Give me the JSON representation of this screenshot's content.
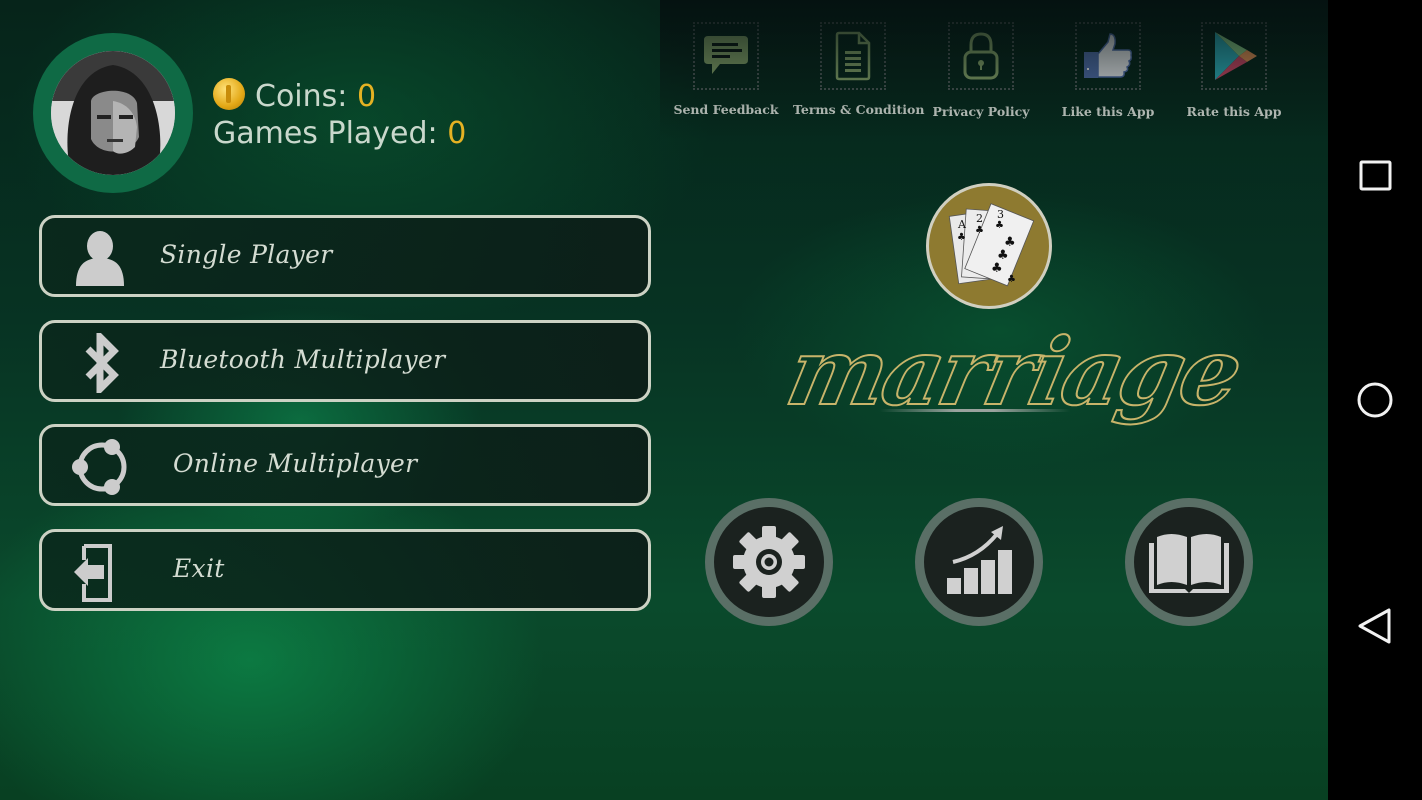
{
  "profile": {
    "avatar_description": "player avatar portrait",
    "coins_label": "Coins: ",
    "coins_value": "0",
    "games_played_label": "Games Played: ",
    "games_played_value": "0"
  },
  "menu": [
    {
      "label": "Single Player",
      "icon": "person-icon"
    },
    {
      "label": "Bluetooth Multiplayer",
      "icon": "bluetooth-icon"
    },
    {
      "label": "Online Multiplayer",
      "icon": "share-network-icon"
    },
    {
      "label": "Exit",
      "icon": "exit-icon"
    }
  ],
  "top_links": [
    {
      "label": "Send Feedback",
      "icon": "chat-bubble-icon"
    },
    {
      "label": "Terms & Condition",
      "icon": "document-icon"
    },
    {
      "label": "Privacy Policy",
      "icon": "lock-icon"
    },
    {
      "label": "Like this App",
      "icon": "thumbs-up-icon"
    },
    {
      "label": "Rate this App",
      "icon": "play-store-icon"
    }
  ],
  "logo": {
    "title": "marriage",
    "cards": [
      "A",
      "2",
      "3"
    ]
  },
  "round_buttons": [
    {
      "name": "settings",
      "icon": "gear-icon"
    },
    {
      "name": "statistics",
      "icon": "chart-growth-icon"
    },
    {
      "name": "rules",
      "icon": "book-icon"
    }
  ],
  "navbar": {
    "recents": "recents-square-icon",
    "home": "home-circle-icon",
    "back": "back-triangle-icon"
  },
  "colors": {
    "accent_value": "#e5b223",
    "button_border": "#ccd2c4",
    "avatar_ring": "#0f6a45",
    "logo_gold": "#8e7a30",
    "icon_green": "#8fb071"
  }
}
